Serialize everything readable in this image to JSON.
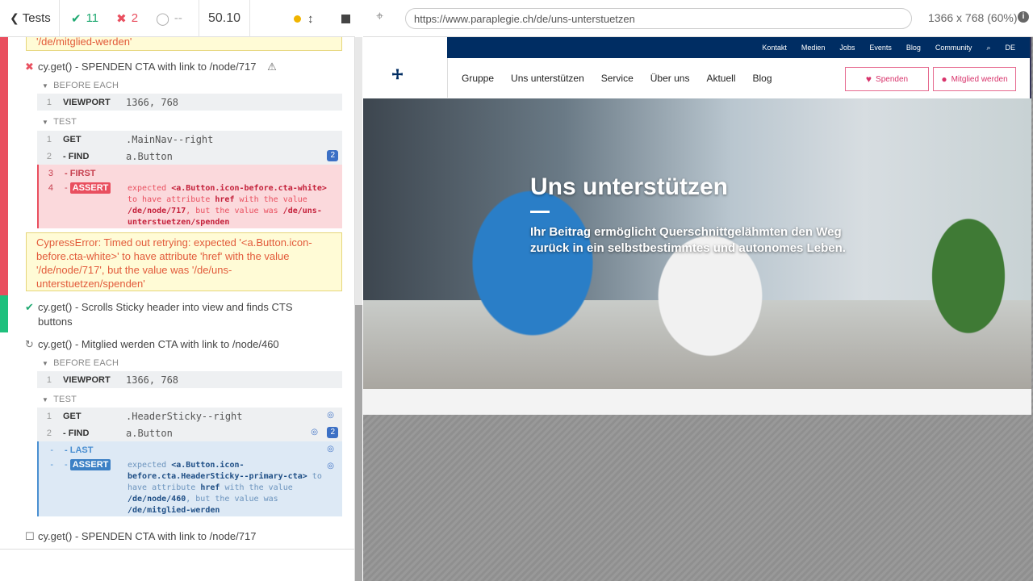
{
  "header": {
    "tests_label": "Tests",
    "passed": "11",
    "failed": "2",
    "pending": "--",
    "duration": "50.10"
  },
  "runs": {
    "prev_error_tail": "'/de/mitglied-werden'",
    "test1": {
      "title": "cy.get() - SPENDEN CTA with link to /node/717",
      "before_each": "BEFORE EACH",
      "test_label": "TEST",
      "viewport_num": "1",
      "viewport_name": "VIEWPORT",
      "viewport_val": "1366, 768",
      "cmds": [
        {
          "num": "1",
          "name": "GET",
          "msg": ".MainNav--right"
        },
        {
          "num": "2",
          "name": "- FIND",
          "msg": "a.Button",
          "badge": "2"
        },
        {
          "num": "3",
          "name": "- FIRST",
          "msg": ""
        },
        {
          "num": "4",
          "name": "- ASSERT",
          "msg_a": "expected",
          "msg_b": "<a.Button.icon-before.cta-white>",
          "msg_c": "to have attribute",
          "msg_d": "href",
          "msg_e": "with the value",
          "msg_f": "/de/node/717",
          "msg_g": ", but the value was",
          "msg_h": "/de/uns-unterstuetzen/spenden"
        }
      ],
      "error": "CypressError: Timed out retrying: expected '<a.Button.icon-before.cta-white>' to have attribute 'href' with the value '/de/node/717', but the value was '/de/uns-unterstuetzen/spenden'"
    },
    "test2": {
      "title": "cy.get() - Scrolls Sticky header into view and finds CTS buttons"
    },
    "test3": {
      "title": "cy.get() - Mitglied werden CTA with link to /node/460",
      "before_each": "BEFORE EACH",
      "test_label": "TEST",
      "viewport_num": "1",
      "viewport_name": "VIEWPORT",
      "viewport_val": "1366, 768",
      "cmds": [
        {
          "num": "1",
          "name": "GET",
          "msg": ".HeaderSticky--right"
        },
        {
          "num": "2",
          "name": "- FIND",
          "msg": "a.Button",
          "badge": "2"
        },
        {
          "num": "-",
          "name": "- LAST",
          "msg": ""
        },
        {
          "num": "-",
          "name": "- ASSERT",
          "msg_a": "expected",
          "msg_b": "<a.Button.icon-before.cta.HeaderSticky--primary-cta>",
          "msg_c": "to have attribute",
          "msg_d": "href",
          "msg_e": "with the value",
          "msg_f": "/de/node/460",
          "msg_g": ", but the value was",
          "msg_h": "/de/mitglied-werden"
        }
      ]
    },
    "test4": {
      "title": "cy.get() - SPENDEN CTA with link to /node/717"
    }
  },
  "aut": {
    "url": "https://www.paraplegie.ch/de/uns-unterstuetzen",
    "viewport": "1366 x 768",
    "scale": "(60%)",
    "site": {
      "top_links": [
        "Kontakt",
        "Medien",
        "Jobs",
        "Events",
        "Blog",
        "Community",
        "DE"
      ],
      "nav": [
        "Gruppe",
        "Uns unterstützen",
        "Service",
        "Über uns",
        "Aktuell",
        "Blog"
      ],
      "cta_spenden": "Spenden",
      "cta_mitglied": "Mitglied werden",
      "hero_title": "Uns unterstützen",
      "hero_text": "Ihr Beitrag ermöglicht Querschnittgelähmten den Weg zurück in ein selbstbestimmtes und autonomes Leben."
    }
  },
  "colors": {
    "pass": "#1fa971",
    "fail": "#e94f5f",
    "navy": "#002d63",
    "accent": "#d8336b"
  }
}
